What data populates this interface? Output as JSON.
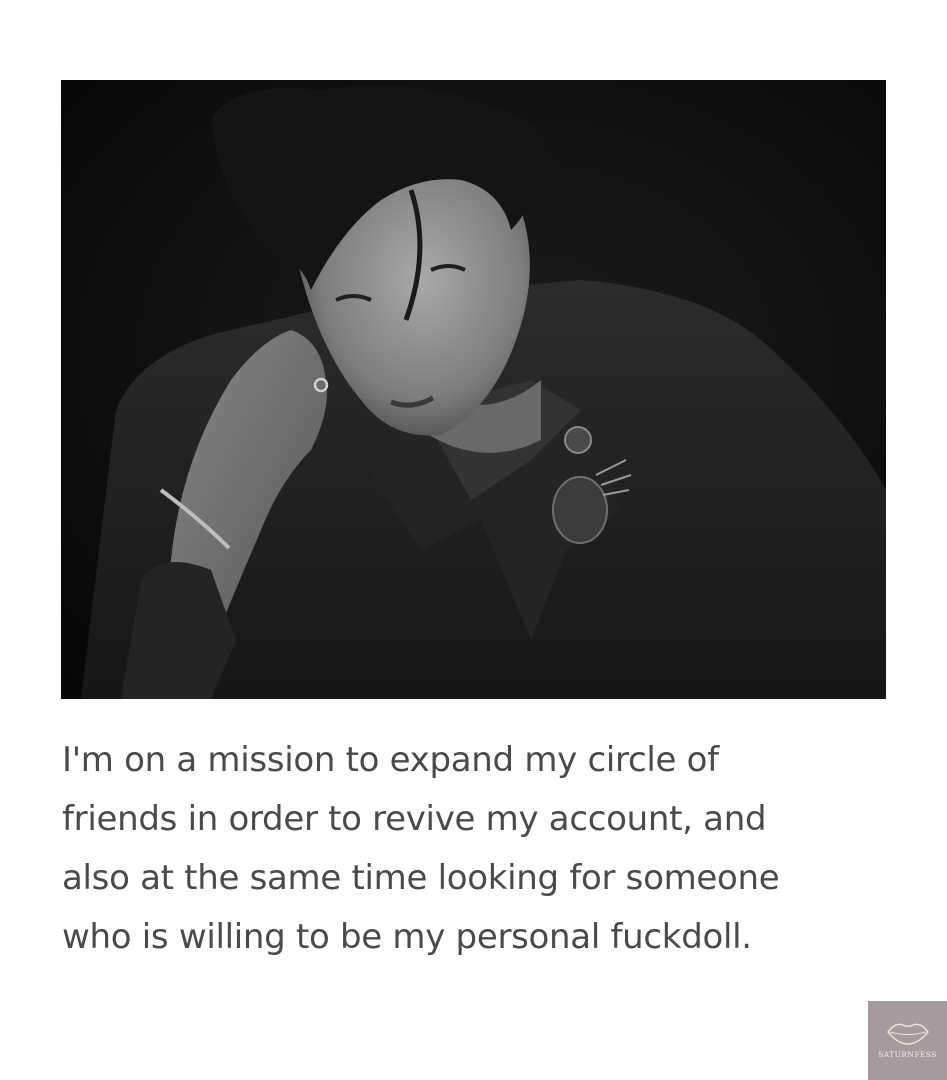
{
  "caption": {
    "text": "I'm on a mission to expand my circle of\nfriends in order to revive my account, and\nalso at the same time looking for someone\nwho is willing to be my personal fuckdoll."
  },
  "photo": {
    "subject": "black-and-white portrait of a man in a dark suit resting his head on his hand"
  },
  "watermark": {
    "label": "SATURNFESS",
    "icon": "lips-icon",
    "background": "#a69a9c"
  },
  "colors": {
    "page_background": "#ffffff",
    "caption_text": "#4a4a4a",
    "photo_background": "#0b0b0b"
  }
}
